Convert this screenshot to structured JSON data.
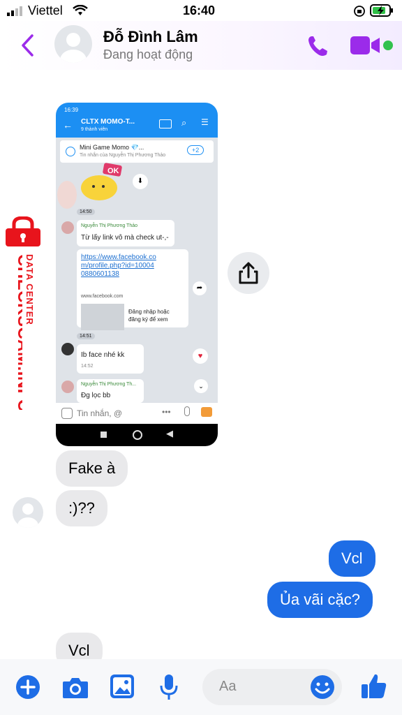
{
  "status_bar": {
    "carrier": "Viettel",
    "time": "16:40"
  },
  "header": {
    "name": "Đỗ Đình Lâm",
    "status": "Đang hoạt động"
  },
  "screenshot": {
    "time": "16:39",
    "group_name": "CLTX MOMO-T...",
    "member_count": "9 thành viên",
    "pinned_title": "Mini Game Momo 💎...",
    "pinned_sub": "Tin nhắn của Nguyễn Thị Phương Thảo",
    "pinned_badge": "+2",
    "sticker_text": "OK",
    "time1": "14:50",
    "sender1": "Nguyễn Thị Phương Thảo",
    "msg1": "Từ lấy link vô mà check ut-,-",
    "link": "https://www.facebook.com/profile.php?id=100040880601138",
    "link_domain": "www.facebook.com",
    "link_preview": "Đăng nhập hoặc đăng ký để xem",
    "time2": "14:51",
    "msg2": "Ib face nhé kk",
    "msg2_time": "14:52",
    "sender2": "Nguyễn Thị Phương Th...",
    "msg3": "Đg lọc bb",
    "composer_placeholder": "Tin nhắn, @"
  },
  "watermark": {
    "brand": "CHECKSCAM.INFO",
    "sub": "DATA CENTER"
  },
  "messages": [
    {
      "dir": "in",
      "text": "Fake à"
    },
    {
      "dir": "in",
      "text": ":)??"
    },
    {
      "dir": "out",
      "text": "Vcl"
    },
    {
      "dir": "out",
      "text": "Ủa vãi cặc?"
    },
    {
      "dir": "in",
      "text": "Vcl"
    }
  ],
  "composer": {
    "placeholder": "Aa"
  },
  "colors": {
    "accent": "#9b2bea",
    "messenger_blue": "#1e6de6",
    "zalo_blue": "#1c8ff3",
    "watermark_red": "#e8141c"
  }
}
